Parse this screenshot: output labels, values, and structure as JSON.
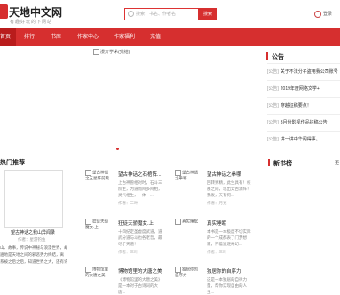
{
  "header": {
    "site_title": "天地中文网",
    "site_subtitle": "有趣好玩的下网站",
    "search_placeholder": "搜索：书名、作者名",
    "search_button": "搜索",
    "user_label": "登录",
    "accent": "#d62f2f"
  },
  "nav": {
    "items": [
      "首页",
      "排行",
      "书库",
      "作家中心",
      "作家福利",
      "充值"
    ]
  },
  "banner": {
    "image_alt": "漫卉学术(完结)"
  },
  "notice": {
    "title": "公告",
    "items": [
      {
        "tag": "[公告]",
        "text": "关于不法分子盗用我公司账号"
      },
      {
        "tag": "[公告]",
        "text": "2019年度网络文学+"
      },
      {
        "tag": "[公告]",
        "text": "穿越征稿要点！"
      },
      {
        "tag": "[公告]",
        "text": "3月份影视作品征稿公告"
      },
      {
        "tag": "[公告]",
        "text": "讲一讲中华阁得事。"
      }
    ]
  },
  "hot": {
    "title": "热门推荐",
    "featured": {
      "title": "望古神话之我山异闻录",
      "author": "作者：星游钓鱼",
      "desc": [
        "山、故事，传说中神秘与浪漫世界，却与",
        "遍地是天地之间的邪恶势力终结，离",
        "系被之后之后，知道世界之大，还有许多"
      ]
    },
    "books": [
      {
        "thumb": "望古神话之五星阵前敌",
        "title": "望古神话之石棺阵...",
        "desc": "上古神兽相对时，石斗三阶生，为道而阿多阿相，灵气相生，一体一...",
        "author": "作者：三叶"
      },
      {
        "thumb": "望古神话之拳哪",
        "title": "望古神话之拳哪",
        "desc": "回转界精，此生具有！校那之间，现出太古源阵！我发，天有何...",
        "author": "作者：月亮"
      },
      {
        "thumb": "狂徒天骄魔女.上",
        "title": "狂徒天骄魔女.上",
        "desc": "十四纪定圣虚度武道，道武分道与斗也各老哲，最尽了天道！",
        "author": "作者：三叶"
      },
      {
        "thumb": "真实睡眠",
        "title": "真实睡眠",
        "desc": "本书是一本极度不切实际的一个成都表了门梦想家，怀着追逐奇幻...",
        "author": "作者：三叶"
      },
      {
        "thumb": "博物馆里的大唐之美",
        "title": "博物馆里的大唐之美",
        "desc": "《博物馆里的大唐之美》是一本对于古诗词的大唐...",
        "author": ""
      },
      {
        "thumb": "独居你的自序力",
        "title": "独居你的自序力",
        "desc": "这是一本独居的自律力量，帮你实现自由的人生...",
        "author": ""
      }
    ]
  },
  "new_books": {
    "title": "新书榜",
    "more": "更"
  }
}
